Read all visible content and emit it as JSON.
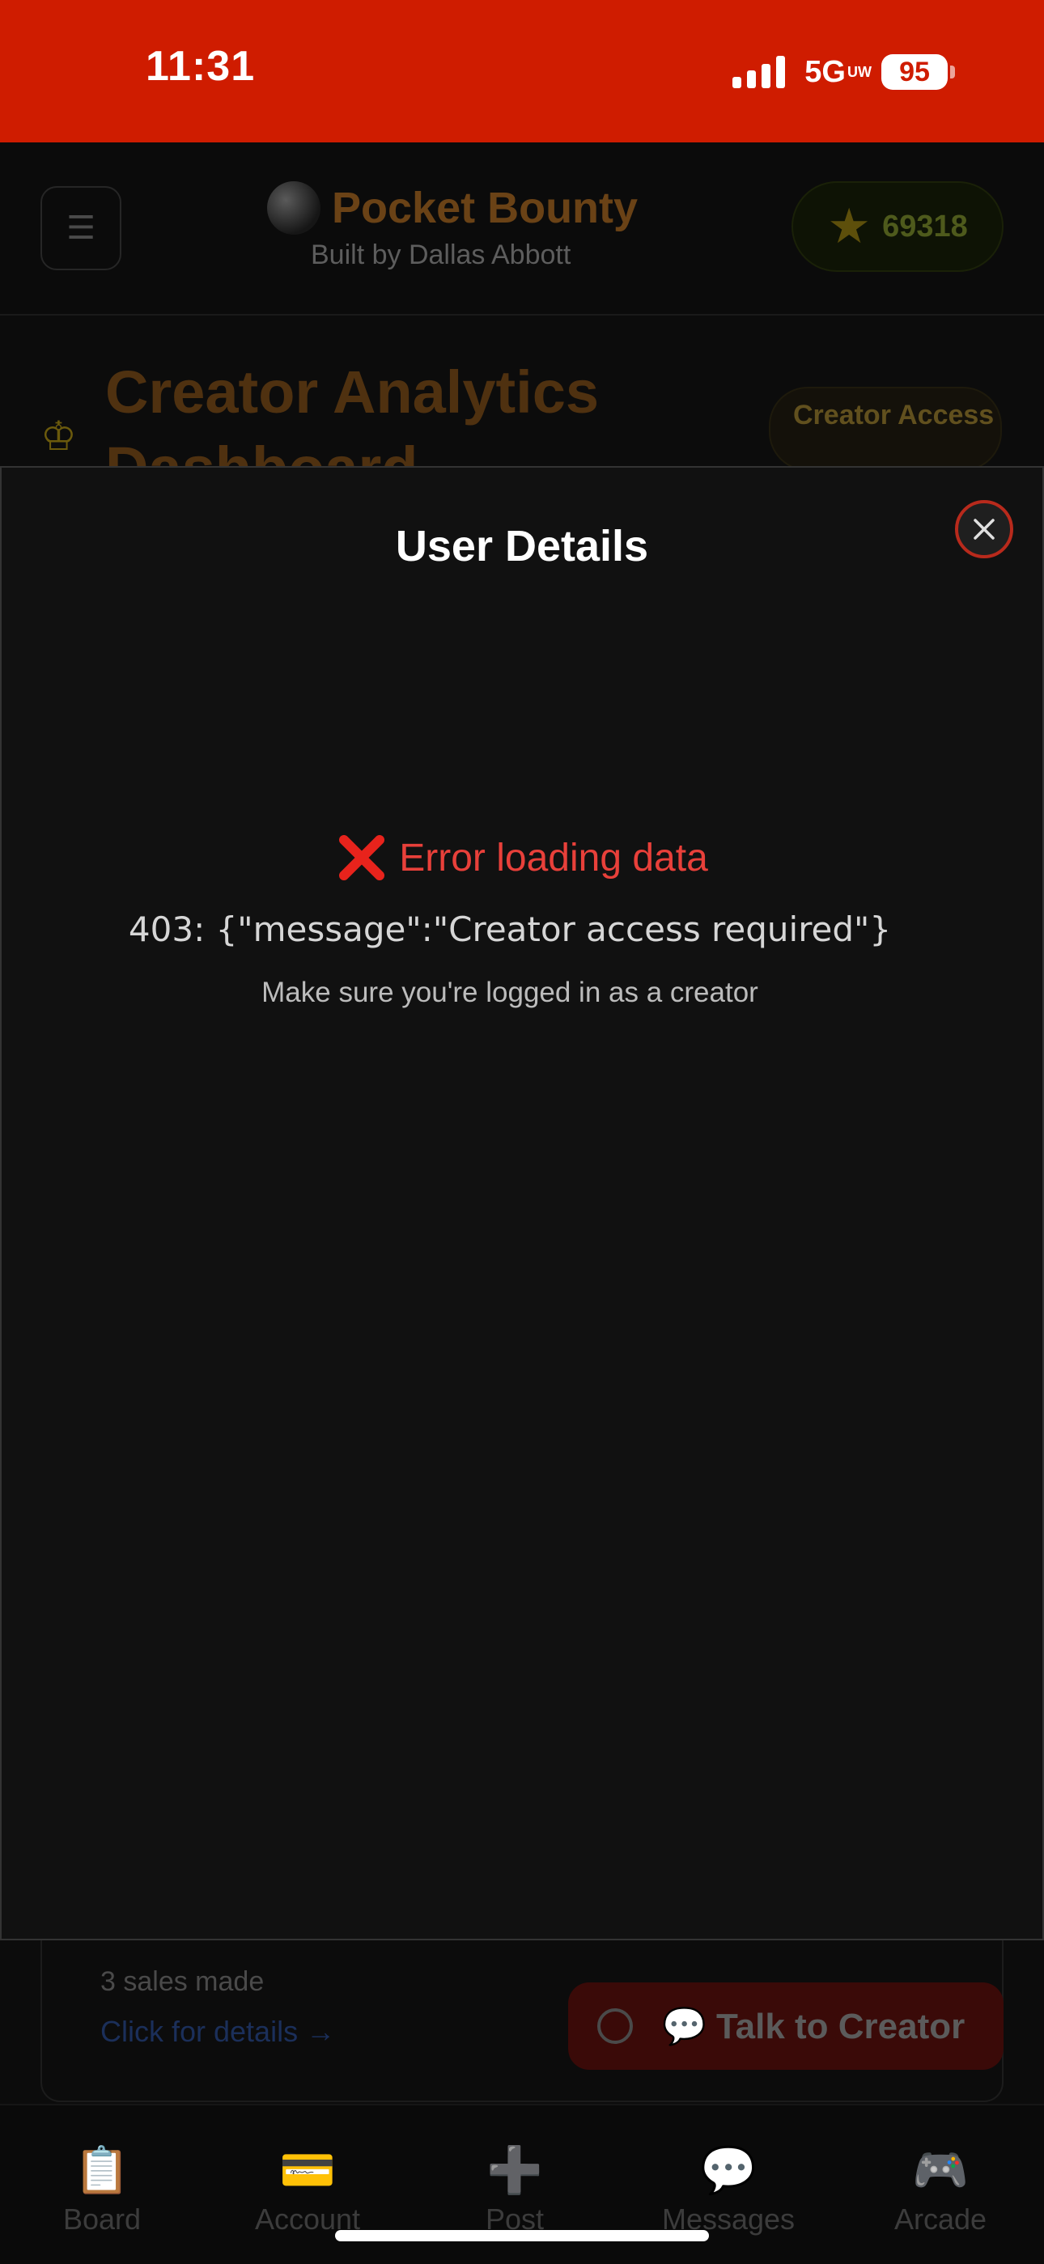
{
  "status_bar": {
    "time": "11:31",
    "network": "5G",
    "network_suffix": "UW",
    "battery": "95",
    "background_color": "#cf1c00"
  },
  "header": {
    "menu_icon": "hamburger-icon",
    "app_name": "Pocket Bounty",
    "subtitle": "Built by Dallas Abbott",
    "points": "69318",
    "points_icon": "star-icon"
  },
  "dashboard": {
    "title": "Creator Analytics Dashboard",
    "badge": "Creator Access",
    "crown_icon": "crown-icon"
  },
  "modal": {
    "title": "User Details",
    "close_icon": "close-icon",
    "error_icon": "cross-mark-icon",
    "error_title": "Error loading data",
    "error_message": "403: {\"message\":\"Creator access required\"}",
    "error_hint": "Make sure you're logged in as a creator",
    "accent_color": "#e8403a"
  },
  "sales_card": {
    "count_text": "3 sales made",
    "link_text": "Click for details →"
  },
  "talk_button": {
    "label": "💬 Talk to Creator"
  },
  "bottom_nav": {
    "items": [
      {
        "label": "Board",
        "icon": "📋"
      },
      {
        "label": "Account",
        "icon": "💳"
      },
      {
        "label": "Post",
        "icon": "➕"
      },
      {
        "label": "Messages",
        "icon": "💬"
      },
      {
        "label": "Arcade",
        "icon": "🎮"
      }
    ]
  }
}
